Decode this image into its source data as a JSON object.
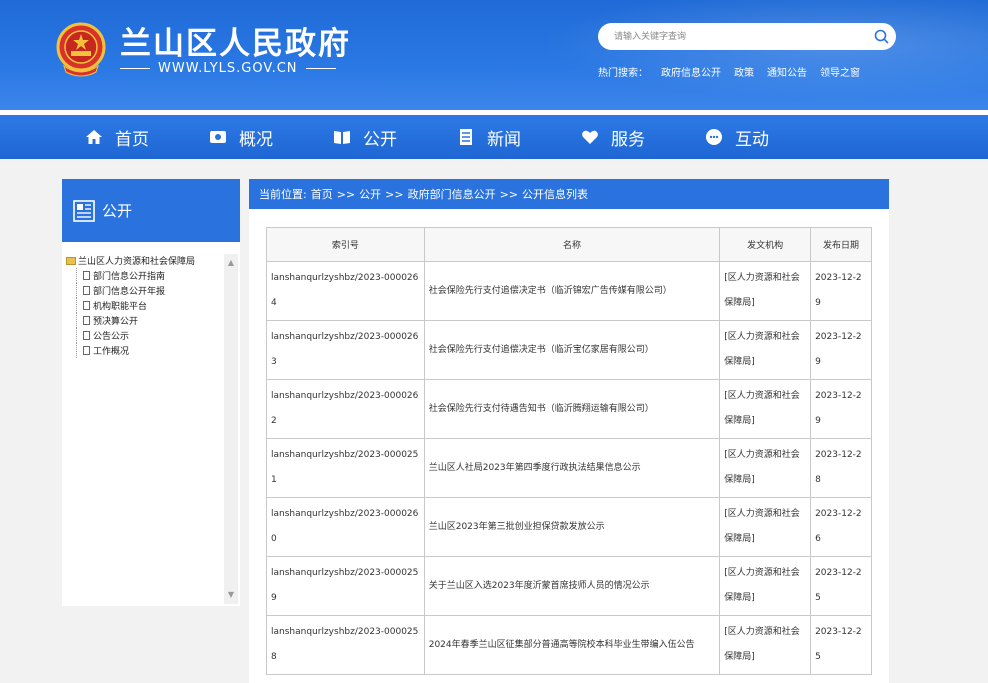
{
  "site": {
    "title": "兰山区人民政府",
    "url": "WWW.LYLS.GOV.CN"
  },
  "search": {
    "placeholder": "请输入关键字查询"
  },
  "hot_search": {
    "label": "热门搜索：",
    "links": [
      "政府信息公开",
      "政策",
      "通知公告",
      "领导之窗"
    ]
  },
  "nav": {
    "items": [
      {
        "label": "首页",
        "icon": "home-icon"
      },
      {
        "label": "概况",
        "icon": "overview-icon"
      },
      {
        "label": "公开",
        "icon": "book-icon"
      },
      {
        "label": "新闻",
        "icon": "news-icon"
      },
      {
        "label": "服务",
        "icon": "heart-hand-icon"
      },
      {
        "label": "互动",
        "icon": "chat-icon"
      }
    ]
  },
  "sidebar": {
    "title": "公开",
    "tree_root": "兰山区人力资源和社会保障局",
    "tree_items": [
      "部门信息公开指南",
      "部门信息公开年报",
      "机构职能平台",
      "预决算公开",
      "公告公示",
      "工作概况"
    ]
  },
  "breadcrumb": {
    "prefix": "当前位置:",
    "items": [
      "首页",
      "公开",
      "政府部门信息公开",
      "公开信息列表"
    ],
    "separator": ">>"
  },
  "table": {
    "headers": [
      "索引号",
      "名称",
      "发文机构",
      "发布日期"
    ],
    "rows": [
      {
        "idx": "lanshanqurlzyshbz/2023-0000264",
        "name": "社会保险先行支付追偿决定书（临沂锦宏广告传媒有限公司）",
        "org": "[区人力资源和社会保障局]",
        "date": "2023-12-29"
      },
      {
        "idx": "lanshanqurlzyshbz/2023-0000263",
        "name": "社会保险先行支付追偿决定书（临沂宝亿家居有限公司）",
        "org": "[区人力资源和社会保障局]",
        "date": "2023-12-29"
      },
      {
        "idx": "lanshanqurlzyshbz/2023-0000262",
        "name": "社会保险先行支付待遇告知书（临沂腾翔运输有限公司）",
        "org": "[区人力资源和社会保障局]",
        "date": "2023-12-29"
      },
      {
        "idx": "lanshanqurlzyshbz/2023-0000251",
        "name": "兰山区人社局2023年第四季度行政执法结果信息公示",
        "org": "[区人力资源和社会保障局]",
        "date": "2023-12-28"
      },
      {
        "idx": "lanshanqurlzyshbz/2023-0000260",
        "name": "兰山区2023年第三批创业担保贷款发放公示",
        "org": "[区人力资源和社会保障局]",
        "date": "2023-12-26"
      },
      {
        "idx": "lanshanqurlzyshbz/2023-0000259",
        "name": "关于兰山区入选2023年度沂蒙首席技师人员的情况公示",
        "org": "[区人力资源和社会保障局]",
        "date": "2023-12-25"
      },
      {
        "idx": "lanshanqurlzyshbz/2023-0000258",
        "name": "2024年春季兰山区征集部分普通高等院校本科毕业生带编入伍公告",
        "org": "[区人力资源和社会保障局]",
        "date": "2023-12-25"
      }
    ]
  },
  "colors": {
    "primary": "#2a73de",
    "header_bg": "#1f6ad6"
  }
}
